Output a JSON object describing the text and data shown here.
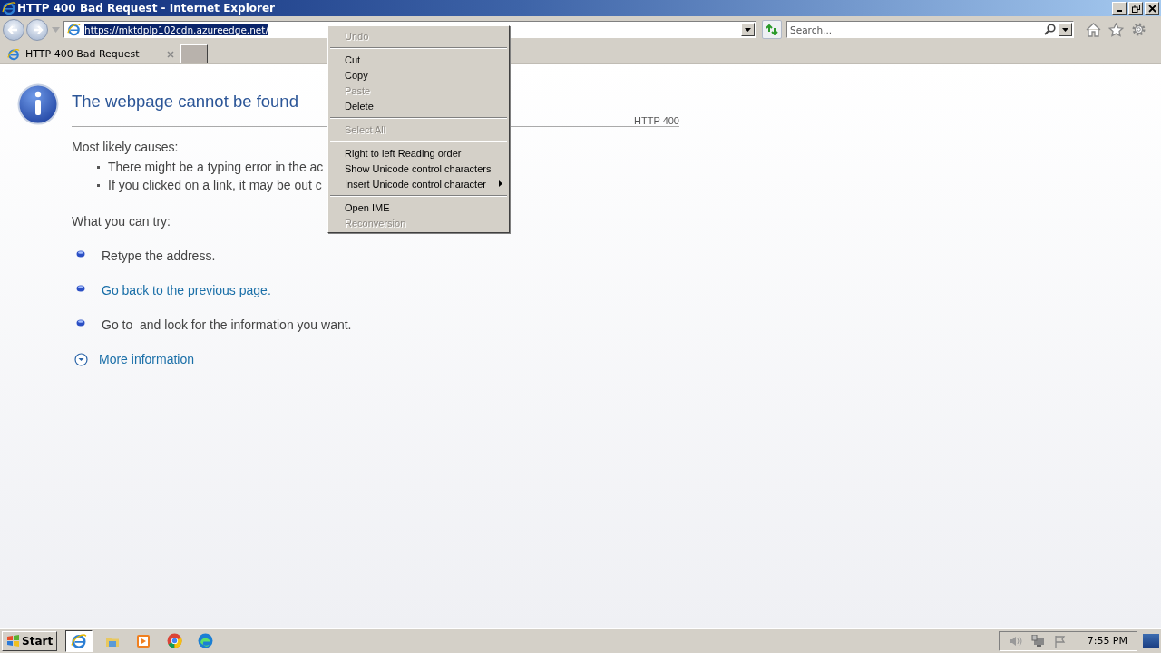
{
  "window": {
    "title": "HTTP 400 Bad Request - Internet Explorer"
  },
  "address_bar": {
    "value": "https://mktdplp102cdn.azureedge.net/",
    "selected": true
  },
  "search": {
    "placeholder": "Search..."
  },
  "tabs": [
    {
      "label": "HTTP 400 Bad Request",
      "selected": true
    }
  ],
  "page": {
    "heading": "The webpage cannot be found",
    "code": "HTTP 400",
    "causes_title": "Most likely causes:",
    "causes": [
      "There might be a typing error in the ac",
      "If you clicked on a link, it may be out c"
    ],
    "try_title": "What you can try:",
    "try_items": [
      {
        "text": "Retype the address.",
        "link": false
      },
      {
        "text": "Go back to the previous page.",
        "link": true
      },
      {
        "text": "Go to  and look for the information you want.",
        "link": false
      }
    ],
    "more": "More information"
  },
  "context_menu": [
    {
      "kind": "item",
      "label": "Undo",
      "disabled": true
    },
    {
      "kind": "separator"
    },
    {
      "kind": "item",
      "label": "Cut",
      "disabled": false
    },
    {
      "kind": "item",
      "label": "Copy",
      "disabled": false
    },
    {
      "kind": "item",
      "label": "Paste",
      "disabled": true
    },
    {
      "kind": "item",
      "label": "Delete",
      "disabled": false
    },
    {
      "kind": "separator"
    },
    {
      "kind": "item",
      "label": "Select All",
      "disabled": true
    },
    {
      "kind": "separator"
    },
    {
      "kind": "item",
      "label": "Right to left Reading order",
      "disabled": false
    },
    {
      "kind": "item",
      "label": "Show Unicode control characters",
      "disabled": false
    },
    {
      "kind": "submenu",
      "label": "Insert Unicode control character",
      "disabled": false
    },
    {
      "kind": "separator"
    },
    {
      "kind": "item",
      "label": "Open IME",
      "disabled": false
    },
    {
      "kind": "item",
      "label": "Reconversion",
      "disabled": true
    }
  ],
  "taskbar": {
    "start": "Start",
    "apps": [
      {
        "kind": "ie",
        "selected": true
      },
      {
        "kind": "folder",
        "selected": false
      },
      {
        "kind": "media",
        "selected": false
      },
      {
        "kind": "chrome",
        "selected": false
      },
      {
        "kind": "edge",
        "selected": false
      }
    ],
    "clock": "7:55 PM"
  }
}
